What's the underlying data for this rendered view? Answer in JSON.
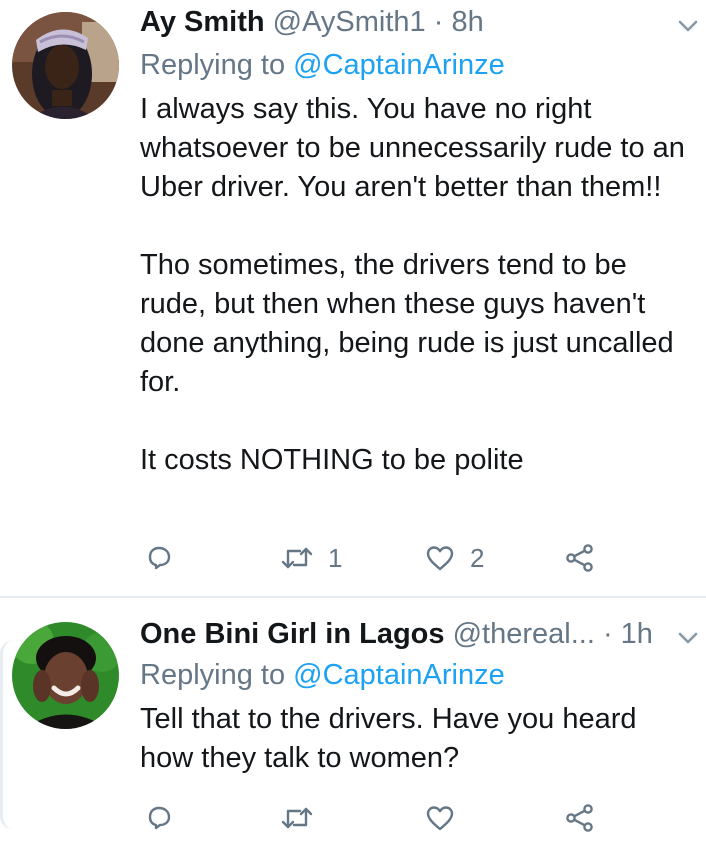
{
  "tweets": [
    {
      "name": "Ay Smith",
      "handle": "@AySmith1",
      "separator": "·",
      "time": "8h",
      "replying_label": "Replying to",
      "replying_to": "@CaptainArinze",
      "paragraphs": [
        "I always say this. You have no right whatsoever to be unnecessarily rude to an Uber driver. You aren't better than them!!",
        "Tho sometimes, the drivers tend to be rude, but then when these guys haven't done anything, being rude is just uncalled for.",
        "It costs NOTHING to be polite"
      ],
      "actions": {
        "reply_icon": "reply-icon",
        "retweet_icon": "retweet-icon",
        "retweet_count": "1",
        "like_icon": "heart-icon",
        "like_count": "2",
        "share_icon": "share-icon"
      }
    },
    {
      "name": "One Bini Girl in Lagos",
      "handle": "@thereal...",
      "separator": "·",
      "time": "1h",
      "replying_label": "Replying to",
      "replying_to": "@CaptainArinze",
      "paragraphs": [
        "Tell that to the drivers. Have you heard how they talk to women?"
      ],
      "actions": {
        "reply_icon": "reply-icon",
        "retweet_icon": "retweet-icon",
        "retweet_count": "",
        "like_icon": "heart-icon",
        "like_count": "",
        "share_icon": "share-icon"
      }
    }
  ],
  "colors": {
    "text": "#14171a",
    "muted": "#657786",
    "link": "#1da1f2",
    "divider": "#e6ecf0"
  }
}
